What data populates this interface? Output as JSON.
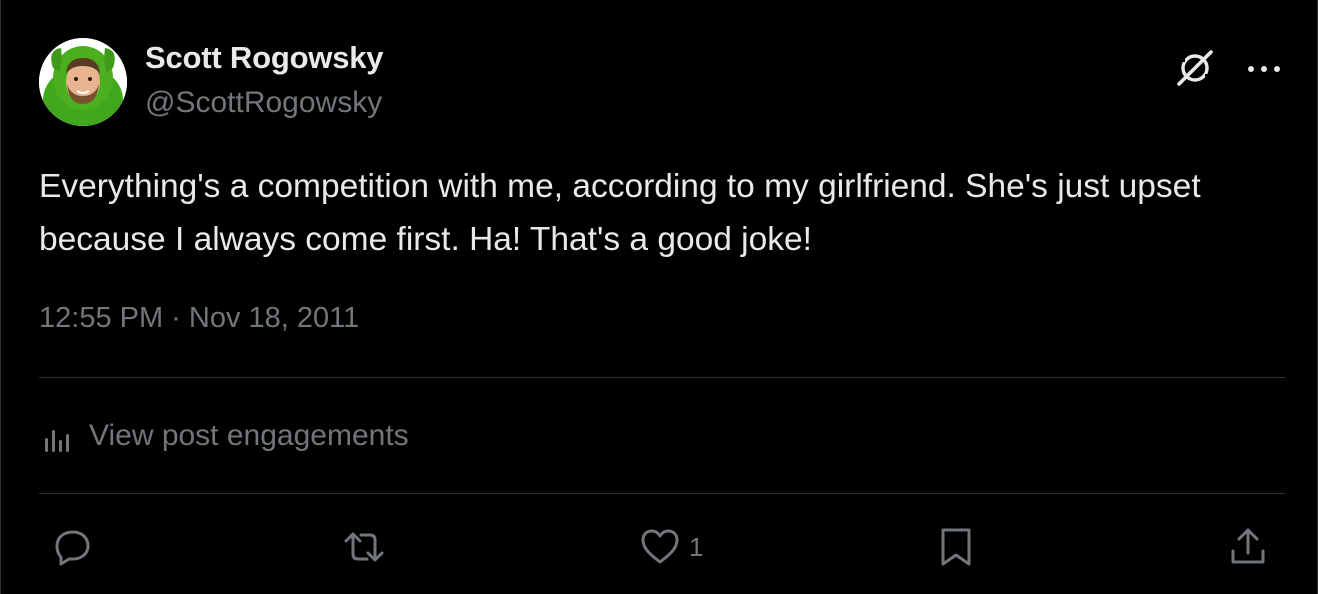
{
  "author": {
    "display_name": "Scott Rogowsky",
    "handle": "@ScottRogowsky"
  },
  "tweet": {
    "text": "Everything's a competition with me, according to my girlfriend. She's just upset because I always come first. Ha! That's a good joke!",
    "timestamp": "12:55 PM · Nov 18, 2011"
  },
  "engagements": {
    "label": "View post engagements"
  },
  "actions": {
    "like_count": "1"
  },
  "icons": {
    "grok": "grok-icon",
    "more": "more-horizontal-icon",
    "analytics": "analytics-bars-icon",
    "reply": "reply-icon",
    "repost": "repost-icon",
    "like": "heart-icon",
    "bookmark": "bookmark-icon",
    "share": "share-icon"
  },
  "colors": {
    "background": "#000000",
    "primary_text": "#e7e9ea",
    "secondary_text": "#71767b",
    "divider": "#2f3336",
    "avatar_accent": "#4caf1f"
  }
}
